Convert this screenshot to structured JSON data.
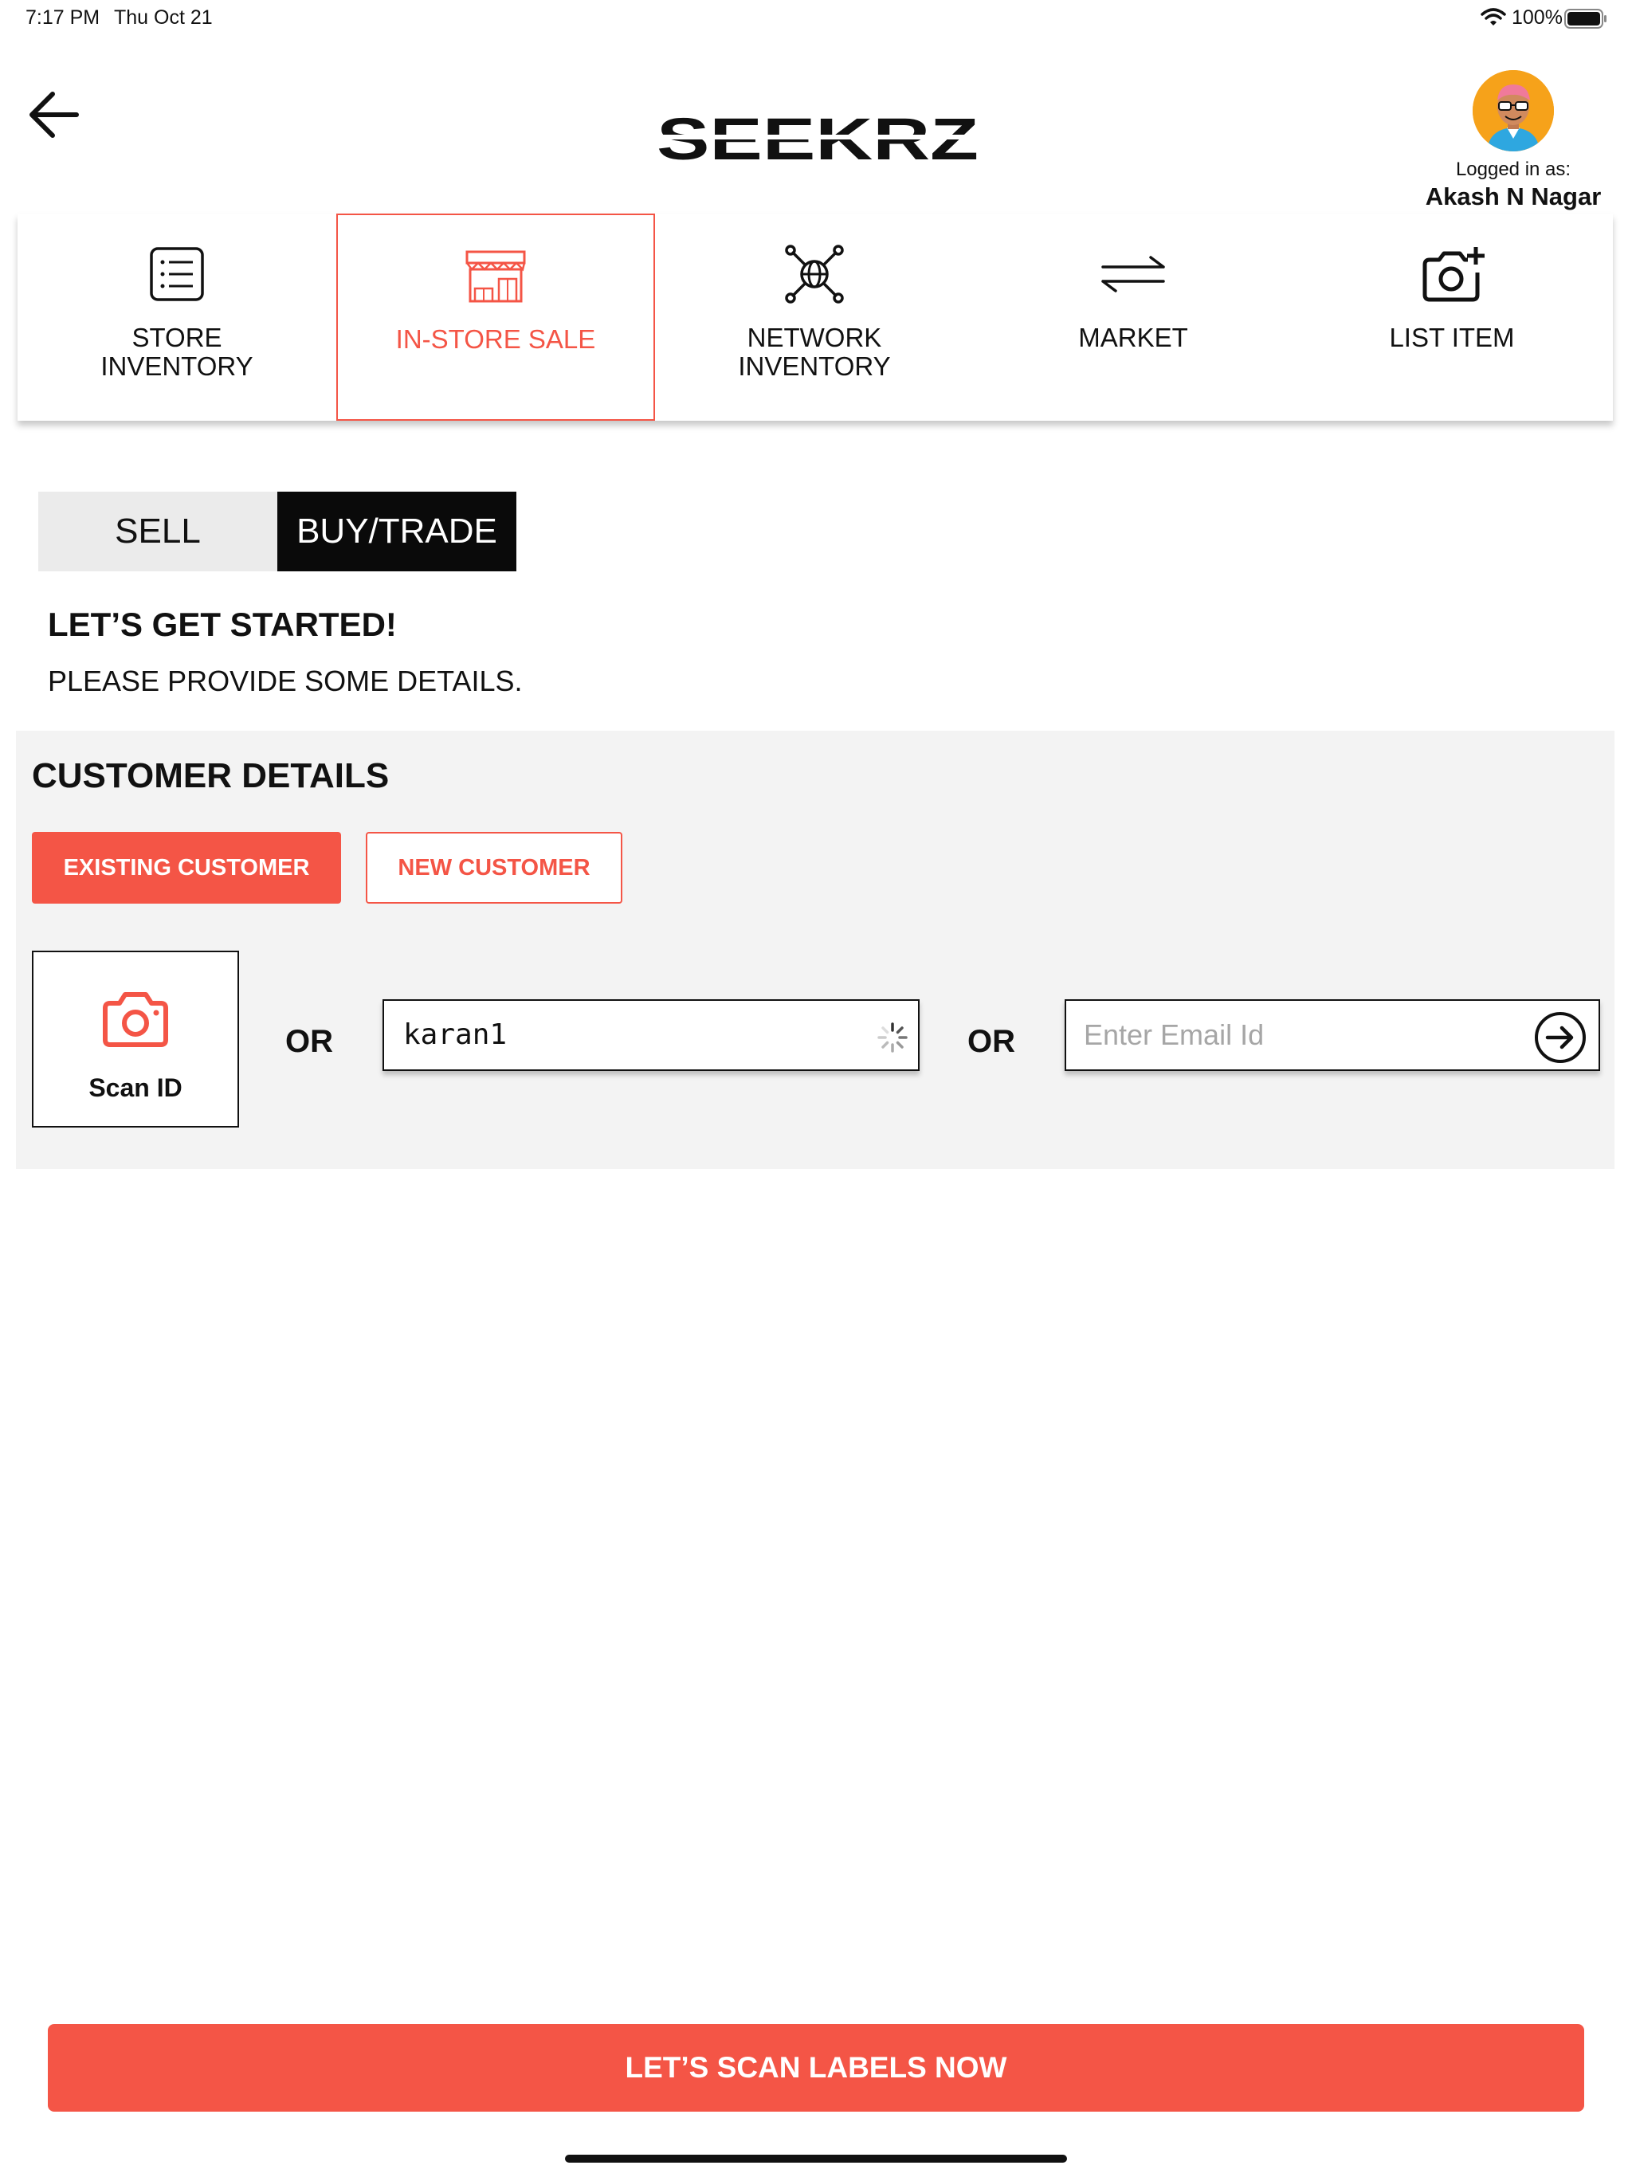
{
  "status_bar": {
    "time": "7:17 PM",
    "date": "Thu Oct 21",
    "battery": "100%",
    "wifi_icon": "wifi-icon",
    "battery_icon": "battery-icon"
  },
  "header": {
    "back_icon": "arrow-left-icon",
    "logo_text": "SEEKRZ",
    "logged_in_label": "Logged in as:",
    "user_name": "Akash N Nagar"
  },
  "nav": {
    "items": [
      {
        "label": "STORE\nINVENTORY",
        "icon": "list-icon",
        "active": false
      },
      {
        "label": "IN-STORE SALE",
        "icon": "storefront-icon",
        "active": true
      },
      {
        "label": "NETWORK\nINVENTORY",
        "icon": "network-globe-icon",
        "active": false
      },
      {
        "label": "MARKET",
        "icon": "swap-arrows-icon",
        "active": false
      },
      {
        "label": "LIST ITEM",
        "icon": "camera-plus-icon",
        "active": false
      }
    ]
  },
  "toggle": {
    "sell_label": "SELL",
    "buy_trade_label": "BUY/TRADE",
    "selected": "BUY/TRADE"
  },
  "intro": {
    "heading": "LET’S GET STARTED!",
    "subheading": "PLEASE PROVIDE SOME DETAILS."
  },
  "customer": {
    "title": "CUSTOMER DETAILS",
    "existing_label": "EXISTING CUSTOMER",
    "new_label": "NEW CUSTOMER",
    "scan_label": "Scan ID",
    "scan_icon": "camera-icon",
    "or_label": "OR",
    "name_value": "karan1",
    "email_placeholder": "Enter Email Id",
    "go_icon": "arrow-right-circle-icon"
  },
  "cta": {
    "label": "LET’S SCAN LABELS NOW"
  },
  "colors": {
    "accent": "#F45546",
    "dark": "#0A0A0A",
    "panel": "#F3F3F3"
  }
}
